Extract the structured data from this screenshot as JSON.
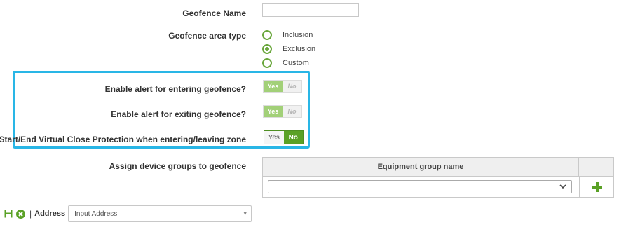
{
  "form": {
    "geofence_name_label": "Geofence Name",
    "geofence_name_value": "",
    "area_type_label": "Geofence area type",
    "area_types": [
      {
        "label": "Inclusion",
        "checked": false
      },
      {
        "label": "Exclusion",
        "checked": true
      },
      {
        "label": "Custom",
        "checked": false
      }
    ],
    "alert_entering_label": "Enable alert for entering geofence?",
    "alert_exiting_label": "Enable alert for exiting geofence?",
    "close_protection_label": "Start/End Virtual Close Protection when entering/leaving zone",
    "toggle_yes": "Yes",
    "toggle_no": "No",
    "toggles": {
      "alert_entering": "Yes",
      "alert_exiting": "Yes",
      "close_protection": "No"
    },
    "assign_groups_label": "Assign device groups to geofence",
    "equipment_header": "Equipment group name",
    "equipment_select_value": ""
  },
  "address_bar": {
    "separator": "|",
    "label": "Address",
    "placeholder": "Input Address"
  },
  "colors": {
    "accent_green": "#5aa126",
    "light_green": "#a2d078",
    "highlight_blue": "#29b6e6",
    "radio_green": "#6aa73d"
  },
  "icons": [
    "save-icon",
    "cancel-icon",
    "chevron-down-icon",
    "plus-icon",
    "caret-down-icon"
  ]
}
